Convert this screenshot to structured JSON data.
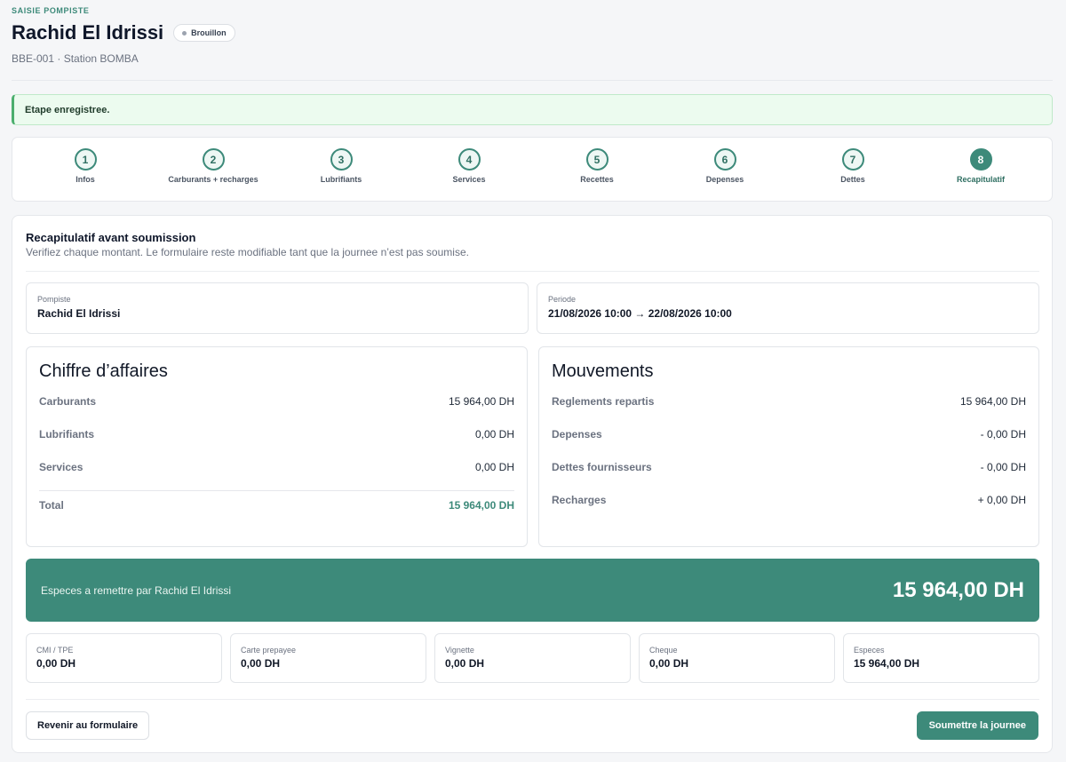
{
  "header": {
    "eyebrow": "SAISIE POMPISTE",
    "title": "Rachid El Idrissi",
    "status_badge": "Brouillon",
    "subtitle": "BBE-001 · Station BOMBA"
  },
  "alert": {
    "message": "Etape enregistree."
  },
  "stepper": {
    "steps": [
      {
        "number": "1",
        "label": "Infos"
      },
      {
        "number": "2",
        "label": "Carburants + recharges"
      },
      {
        "number": "3",
        "label": "Lubrifiants"
      },
      {
        "number": "4",
        "label": "Services"
      },
      {
        "number": "5",
        "label": "Recettes"
      },
      {
        "number": "6",
        "label": "Depenses"
      },
      {
        "number": "7",
        "label": "Dettes"
      },
      {
        "number": "8",
        "label": "Recapitulatif"
      }
    ],
    "active_step": "8"
  },
  "summary": {
    "title": "Recapitulatif avant soumission",
    "subtitle": "Verifiez chaque montant. Le formulaire reste modifiable tant que la journee n’est pas soumise.",
    "pompiste": {
      "label": "Pompiste",
      "value": "Rachid El Idrissi"
    },
    "periode": {
      "label": "Periode",
      "value": "21/08/2026 10:00 → 22/08/2026 10:00"
    },
    "revenue": {
      "title": "Chiffre d’affaires",
      "rows": [
        {
          "label": "Carburants",
          "value": "15 964,00 DH"
        },
        {
          "label": "Lubrifiants",
          "value": "0,00 DH"
        },
        {
          "label": "Services",
          "value": "0,00 DH"
        }
      ],
      "total": {
        "label": "Total",
        "value": "15 964,00 DH"
      }
    },
    "movements": {
      "title": "Mouvements",
      "rows": [
        {
          "label": "Reglements repartis",
          "value": "15 964,00 DH"
        },
        {
          "label": "Depenses",
          "value": "- 0,00 DH"
        },
        {
          "label": "Dettes fournisseurs",
          "value": "- 0,00 DH"
        },
        {
          "label": "Recharges",
          "value": "+ 0,00 DH"
        }
      ]
    },
    "cash": {
      "label": "Especes a remettre par Rachid El Idrissi",
      "amount": "15 964,00 DH"
    },
    "payments": [
      {
        "label": "CMI / TPE",
        "value": "0,00 DH"
      },
      {
        "label": "Carte prepayee",
        "value": "0,00 DH"
      },
      {
        "label": "Vignette",
        "value": "0,00 DH"
      },
      {
        "label": "Cheque",
        "value": "0,00 DH"
      },
      {
        "label": "Especes",
        "value": "15 964,00 DH"
      }
    ]
  },
  "actions": {
    "back_label": "Revenir au formulaire",
    "submit_label": "Soumettre la journee"
  },
  "colors": {
    "accent": "#3d8a7a",
    "alert_bg": "#ecfbef",
    "alert_border": "#4caf6e",
    "page_bg": "#f5f6f8"
  }
}
